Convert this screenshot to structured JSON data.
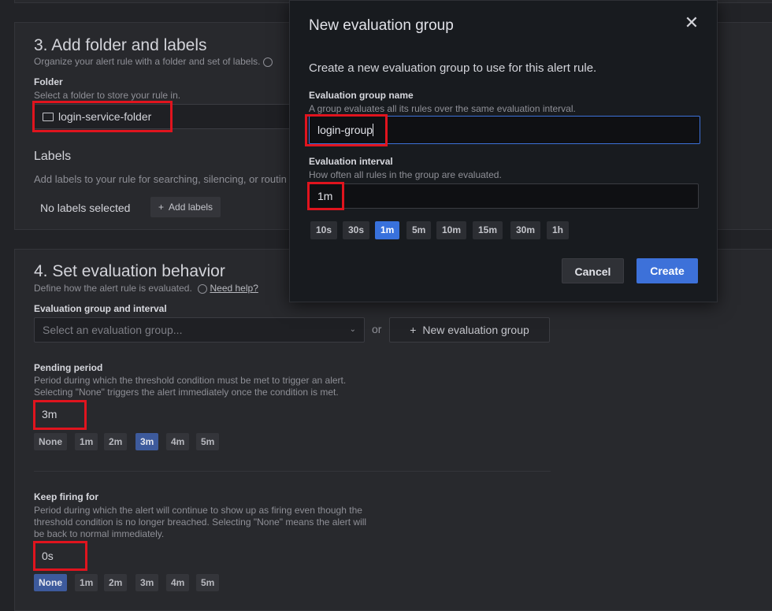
{
  "section3": {
    "title": "3. Add folder and labels",
    "subtitle": "Organize your alert rule with a folder and set of labels.",
    "folder_label": "Folder",
    "folder_desc": "Select a folder to store your rule in.",
    "folder_value": "login-service-folder",
    "labels_title": "Labels",
    "labels_desc": "Add labels to your rule for searching, silencing, or routin",
    "no_labels": "No labels selected",
    "add_labels": "Add labels"
  },
  "section4": {
    "title": "4. Set evaluation behavior",
    "subtitle": "Define how the alert rule is evaluated.",
    "help_link": "Need help?",
    "group_label": "Evaluation group and interval",
    "group_placeholder": "Select an evaluation group...",
    "or_text": "or",
    "new_group_button": "New evaluation group",
    "pending_label": "Pending period",
    "pending_desc_1": "Period during which the threshold condition must be met to trigger an alert.",
    "pending_desc_2": "Selecting \"None\" triggers the alert immediately once the condition is met.",
    "pending_value": "3m",
    "pending_options": [
      "None",
      "1m",
      "2m",
      "3m",
      "4m",
      "5m"
    ],
    "pending_selected": "3m",
    "keep_label": "Keep firing for",
    "keep_desc_1": "Period during which the alert will continue to show up as firing even though the",
    "keep_desc_2": "threshold condition is no longer breached. Selecting \"None\" means the alert will",
    "keep_desc_3": "be back to normal immediately.",
    "keep_value": "0s",
    "keep_options": [
      "None",
      "1m",
      "2m",
      "3m",
      "4m",
      "5m"
    ],
    "keep_selected": "None"
  },
  "modal": {
    "title": "New evaluation group",
    "intro": "Create a new evaluation group to use for this alert rule.",
    "name_label": "Evaluation group name",
    "name_desc": "A group evaluates all its rules over the same evaluation interval.",
    "name_value": "login-group",
    "interval_label": "Evaluation interval",
    "interval_desc": "How often all rules in the group are evaluated.",
    "interval_value": "1m",
    "interval_options": [
      "10s",
      "30s",
      "1m",
      "5m",
      "10m",
      "15m",
      "30m",
      "1h"
    ],
    "interval_selected": "1m",
    "cancel": "Cancel",
    "create": "Create"
  },
  "colors": {
    "primary": "#3d71d9",
    "highlight": "#e0141e",
    "chip_selected": "#3871dc"
  }
}
